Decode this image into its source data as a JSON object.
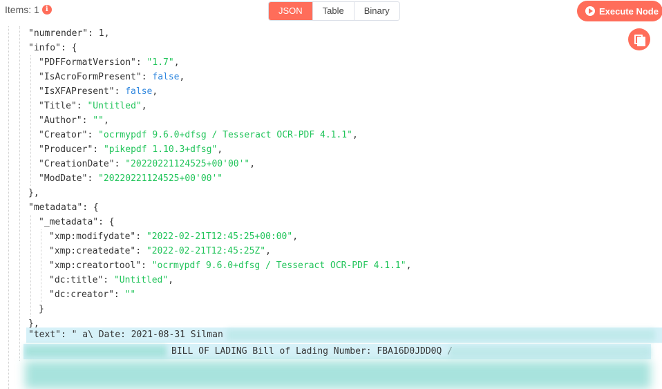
{
  "header": {
    "items_label": "Items: 1",
    "info_icon": "info-icon",
    "tabs": [
      "JSON",
      "Table",
      "Binary"
    ],
    "active_tab": "JSON",
    "execute_label": "Execute Node"
  },
  "colors": {
    "accent": "#ff6d5a",
    "string": "#21c45a",
    "boolean": "#2e86de",
    "highlight": "#d6f1f8"
  },
  "json": {
    "numrender_key": "\"numrender\"",
    "numrender_val": "1",
    "info_key": "\"info\"",
    "info": [
      {
        "k": "\"PDFFormatVersion\"",
        "v": "\"1.7\"",
        "t": "s",
        "c": ","
      },
      {
        "k": "\"IsAcroFormPresent\"",
        "v": "false",
        "t": "b",
        "c": ","
      },
      {
        "k": "\"IsXFAPresent\"",
        "v": "false",
        "t": "b",
        "c": ","
      },
      {
        "k": "\"Title\"",
        "v": "\"Untitled\"",
        "t": "s",
        "c": ","
      },
      {
        "k": "\"Author\"",
        "v": "\"\"",
        "t": "s",
        "c": ","
      },
      {
        "k": "\"Creator\"",
        "v": "\"ocrmypdf 9.6.0+dfsg / Tesseract OCR-PDF 4.1.1\"",
        "t": "s",
        "c": ","
      },
      {
        "k": "\"Producer\"",
        "v": "\"pikepdf 1.10.3+dfsg\"",
        "t": "s",
        "c": ","
      },
      {
        "k": "\"CreationDate\"",
        "v": "\"20220221124525+00'00'\"",
        "t": "s",
        "c": ","
      },
      {
        "k": "\"ModDate\"",
        "v": "\"20220221124525+00'00'\"",
        "t": "s",
        "c": ""
      }
    ],
    "metadata_key": "\"metadata\"",
    "inner_metadata_key": "\"_metadata\"",
    "metadata": [
      {
        "k": "\"xmp:modifydate\"",
        "v": "\"2022-02-21T12:45:25+00:00\"",
        "t": "s",
        "c": ","
      },
      {
        "k": "\"xmp:createdate\"",
        "v": "\"2022-02-21T12:45:25Z\"",
        "t": "s",
        "c": ","
      },
      {
        "k": "\"xmp:creatortool\"",
        "v": "\"ocrmypdf 9.6.0+dfsg / Tesseract OCR-PDF 4.1.1\"",
        "t": "s",
        "c": ","
      },
      {
        "k": "\"dc:title\"",
        "v": "\"Untitled\"",
        "t": "s",
        "c": ","
      },
      {
        "k": "\"dc:creator\"",
        "v": "\"\"",
        "t": "s",
        "c": ""
      }
    ],
    "text_key": "\"text\"",
    "text_line1": "\" a\\ Date: 2021-08-31 Silman",
    "text_line2": "BILL OF LADING Bill of Lading Number: FBA16D0JDD0Q /"
  }
}
